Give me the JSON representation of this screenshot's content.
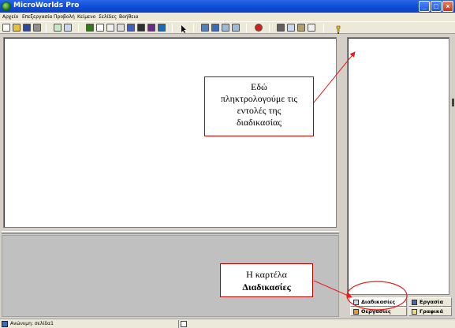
{
  "window": {
    "title": "MicroWorlds Pro",
    "controls": {
      "minimize": "_",
      "maximize": "□",
      "close": "×"
    }
  },
  "menu": [
    "Αρχείο",
    "Επεξεργασία",
    "Προβολή",
    "Κείμενο",
    "Σελίδες",
    "Βοήθεια"
  ],
  "toolbar": {
    "tools": [
      "new-icon",
      "open-icon",
      "save-icon",
      "print-icon",
      "page-view-icon",
      "procedure-view-icon",
      "turtle-icon",
      "text-box-icon",
      "button-icon",
      "slider-icon",
      "music-icon",
      "sound-icon",
      "video-icon",
      "globe-icon",
      "pointer-icon",
      "eye-icon",
      "stamp-icon",
      "grow-icon",
      "shrink-icon",
      "stop-icon",
      "cut-icon",
      "copy-icon",
      "paste-icon",
      "undo-icon",
      "help-icon"
    ],
    "colors": {
      "new-icon": "#ffffff",
      "open-icon": "#e8c040",
      "save-icon": "#2a4a9a",
      "print-icon": "#909090",
      "page-view-icon": "#c8e8c8",
      "procedure-view-icon": "#c8d8f0",
      "turtle-icon": "#2e7d1a",
      "text-box-icon": "#ffffff",
      "button-icon": "#f0f0f0",
      "slider-icon": "#dddddd",
      "music-icon": "#4060c0",
      "sound-icon": "#303030",
      "video-icon": "#6a2a8a",
      "globe-icon": "#1a6ab8",
      "pointer-icon": "#ece9d8",
      "eye-icon": "#5080c0",
      "stamp-icon": "#3a6ab8",
      "grow-icon": "#a0b8d8",
      "shrink-icon": "#a0b8d8",
      "stop-icon": "#d02020",
      "cut-icon": "#606060",
      "copy-icon": "#c8d8f0",
      "paste-icon": "#b0a070",
      "undo-icon": "#f0f0f0",
      "help-icon": "#e0c020"
    }
  },
  "tabs": {
    "procedures": "Διαδικασίες",
    "project": "Εργασία",
    "operations": "Οεργασίες",
    "graphics": "Γραφικά"
  },
  "status": {
    "text": "Ανώνυμη: σελίδα1"
  },
  "annotations": {
    "top": [
      "Εδώ",
      "πληκτρολογούμε τις",
      "εντολές της",
      "διαδικασίας"
    ],
    "bottom": [
      "Η καρτέλα",
      "Διαδικασίες"
    ],
    "accent_color": "#e02020"
  }
}
